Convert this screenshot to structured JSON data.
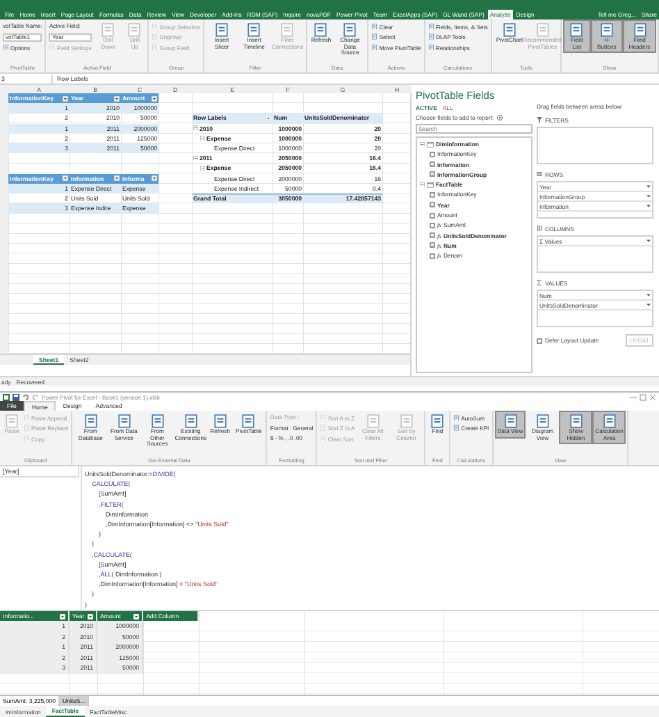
{
  "excel": {
    "ribbon_tabs": [
      {
        "label": "File",
        "selected": false
      },
      {
        "label": "Home",
        "selected": false
      },
      {
        "label": "Insert",
        "selected": false
      },
      {
        "label": "Page Layout",
        "selected": false
      },
      {
        "label": "Formulas",
        "selected": false
      },
      {
        "label": "Data",
        "selected": false
      },
      {
        "label": "Review",
        "selected": false
      },
      {
        "label": "View",
        "selected": false
      },
      {
        "label": "Developer",
        "selected": false
      },
      {
        "label": "Add-ins",
        "selected": false
      },
      {
        "label": "RDM (SAP)",
        "selected": false
      },
      {
        "label": "Inquire",
        "selected": false
      },
      {
        "label": "novaPDF",
        "selected": false
      },
      {
        "label": "Power Pivot",
        "selected": false
      },
      {
        "label": "Team",
        "selected": false
      },
      {
        "label": "ExcelApps (SAP)",
        "selected": false
      },
      {
        "label": "GL Wand (SAP)",
        "selected": false
      },
      {
        "label": "Analyze",
        "selected": true
      },
      {
        "label": "Design",
        "selected": false
      }
    ],
    "tell_me": "Tell me Greg...",
    "share": "Share",
    "ribbon_groups": [
      {
        "label": "PivotTable",
        "buttons": [
          {
            "label": "votTable Name:",
            "kind": "label"
          },
          {
            "label": "votTable1",
            "kind": "field"
          },
          {
            "label": "Options",
            "kind": "small",
            "disabled": false,
            "pressed": false
          }
        ]
      },
      {
        "label": "Active Field",
        "buttons": [
          {
            "label": "Active Field:",
            "kind": "label"
          },
          {
            "label": "Year",
            "kind": "field"
          },
          {
            "label": "Field Settings",
            "kind": "small",
            "disabled": true,
            "pressed": false
          },
          {
            "label": "Drill Down",
            "kind": "large",
            "disabled": true,
            "pressed": false
          },
          {
            "label": "Drill Up",
            "kind": "large",
            "disabled": true,
            "pressed": false
          }
        ]
      },
      {
        "label": "Group",
        "buttons": [
          {
            "label": "Group Selection",
            "kind": "small",
            "disabled": true,
            "pressed": false
          },
          {
            "label": "Ungroup",
            "kind": "small",
            "disabled": true,
            "pressed": false
          },
          {
            "label": "Group Field",
            "kind": "small",
            "disabled": true,
            "pressed": false
          }
        ]
      },
      {
        "label": "Filter",
        "buttons": [
          {
            "label": "Insert Slicer",
            "kind": "large",
            "disabled": false,
            "pressed": false
          },
          {
            "label": "Insert Timeline",
            "kind": "large",
            "disabled": false,
            "pressed": false
          },
          {
            "label": "Filter Connections",
            "kind": "large",
            "disabled": true,
            "pressed": false
          }
        ]
      },
      {
        "label": "Data",
        "buttons": [
          {
            "label": "Refresh",
            "kind": "large",
            "disabled": false,
            "pressed": false
          },
          {
            "label": "Change Data Source",
            "kind": "large",
            "disabled": false,
            "pressed": false
          }
        ]
      },
      {
        "label": "Actions",
        "buttons": [
          {
            "label": "Clear",
            "kind": "small",
            "disabled": false,
            "pressed": false
          },
          {
            "label": "Select",
            "kind": "small",
            "disabled": false,
            "pressed": false
          },
          {
            "label": "Move PivotTable",
            "kind": "small",
            "disabled": false,
            "pressed": false
          }
        ]
      },
      {
        "label": "Calculations",
        "buttons": [
          {
            "label": "Fields, Items, & Sets",
            "kind": "small",
            "disabled": false,
            "pressed": false
          },
          {
            "label": "OLAP Tools",
            "kind": "small",
            "disabled": false,
            "pressed": false
          },
          {
            "label": "Relationships",
            "kind": "small",
            "disabled": false,
            "pressed": false
          }
        ]
      },
      {
        "label": "Tools",
        "buttons": [
          {
            "label": "PivotChart",
            "kind": "large",
            "disabled": false,
            "pressed": false
          },
          {
            "label": "Recommended PivotTables",
            "kind": "large",
            "disabled": true,
            "pressed": false
          }
        ]
      },
      {
        "label": "Show",
        "buttons": [
          {
            "label": "Field List",
            "kind": "large",
            "disabled": false,
            "pressed": true
          },
          {
            "label": "+/- Buttons",
            "kind": "large",
            "disabled": false,
            "pressed": true
          },
          {
            "label": "Field Headers",
            "kind": "large",
            "disabled": false,
            "pressed": true
          }
        ]
      }
    ],
    "name_box": "3",
    "formula": "Row Labels",
    "sheet": {
      "columns": [
        "A",
        "B",
        "C",
        "D",
        "E",
        "F",
        "G",
        "H"
      ],
      "tables": [
        {
          "header": [
            "InformationKey",
            "Year",
            "Amount"
          ],
          "rows": [
            [
              "1",
              "2010",
              "1000000"
            ],
            [
              "2",
              "2010",
              "50000"
            ],
            [
              "1",
              "2011",
              "2000000"
            ],
            [
              "2",
              "2011",
              "125000"
            ],
            [
              "3",
              "2011",
              "50000"
            ]
          ]
        },
        {
          "header": [
            "InformationKey",
            "Information",
            "Informa"
          ],
          "rows": [
            [
              "1",
              "Expense Direct",
              "Expense"
            ],
            [
              "2",
              "Units Sold",
              "Units Sold"
            ],
            [
              "3",
              "Expense Indire",
              "Expense"
            ]
          ]
        }
      ],
      "pivot": {
        "columns": [
          "Row Labels",
          "Num",
          "UnitsSoldDenominator"
        ],
        "rows": [
          {
            "label": "2010",
            "values": [
              "1000000",
              "20"
            ],
            "expanded": true,
            "children": [
              {
                "label": "Expense",
                "values": [
                  "1000000",
                  "20"
                ],
                "expanded": true,
                "children": [
                  {
                    "label": "Expense Direct",
                    "values": [
                      "1000000",
                      "20"
                    ]
                  }
                ]
              }
            ]
          },
          {
            "label": "2011",
            "values": [
              "2050000",
              "16.4"
            ],
            "expanded": true,
            "children": [
              {
                "label": "Expense",
                "values": [
                  "2050000",
                  "16.4"
                ],
                "expanded": true,
                "children": [
                  {
                    "label": "Expense Direct",
                    "values": [
                      "2000000",
                      "16"
                    ]
                  },
                  {
                    "label": "Expense Indirect",
                    "values": [
                      "50000",
                      "0.4"
                    ]
                  }
                ]
              }
            ]
          }
        ],
        "grand_total": {
          "label": "Grand Total",
          "values": [
            "3050000",
            "17.42857143"
          ]
        }
      }
    },
    "sheet_tabs": [
      {
        "label": "Sheet1",
        "selected": true
      },
      {
        "label": "Sheet2",
        "selected": false
      }
    ],
    "status": [
      "ady",
      "Recovered"
    ],
    "field_list": {
      "title": "PivotTable Fields",
      "tabs": [
        {
          "label": "ACTIVE",
          "selected": true
        },
        {
          "label": "ALL",
          "selected": false
        }
      ],
      "choose_label": "Choose fields to add to report:",
      "search": {
        "placeholder": "Search"
      },
      "tables": [
        {
          "name": "DimInformation",
          "expanded": true,
          "fields": [
            {
              "name": "InformationKey",
              "kind": "column",
              "checked": false
            },
            {
              "name": "Information",
              "kind": "column",
              "checked": true
            },
            {
              "name": "InformationGroup",
              "kind": "column",
              "checked": true
            }
          ]
        },
        {
          "name": "FactTable",
          "expanded": true,
          "fields": [
            {
              "name": "InformationKey",
              "kind": "column",
              "checked": false
            },
            {
              "name": "Year",
              "kind": "column",
              "checked": true
            },
            {
              "name": "Amount",
              "kind": "column",
              "checked": false
            },
            {
              "name": "SumAmt",
              "kind": "measure",
              "symbol": "fx",
              "checked": false
            },
            {
              "name": "UnitsSoldDenominator",
              "kind": "measure",
              "symbol": "fx",
              "checked": true
            },
            {
              "name": "Num",
              "kind": "measure",
              "symbol": "fx",
              "checked": true
            },
            {
              "name": "Denom",
              "kind": "measure",
              "symbol": "fx",
              "checked": false
            }
          ]
        }
      ],
      "drag_label": "Drag fields between areas below:",
      "areas": [
        {
          "label": "FILTERS"
        },
        {
          "label": "ROWS",
          "items": [
            "Year",
            "InformationGroup",
            "Information"
          ]
        },
        {
          "label": "COLUMNS",
          "items": [
            "Σ Values"
          ]
        },
        {
          "label": "VALUES",
          "items": [
            "Num",
            "UnitsSoldDenominator"
          ]
        }
      ],
      "defer": {
        "label": "Defer Layout Update",
        "checked": false
      },
      "update": {
        "label": "UPDAT",
        "disabled": true
      }
    }
  },
  "power_pivot": {
    "title": "Power Pivot for Excel - Book1 (version 1).xlsb",
    "tabs": [
      {
        "label": "File",
        "kind": "file",
        "selected": false
      },
      {
        "label": "Home",
        "kind": "tab",
        "selected": true
      },
      {
        "label": "Design",
        "kind": "tab",
        "selected": false
      },
      {
        "label": "Advanced",
        "kind": "tab",
        "selected": false
      }
    ],
    "ribbon_groups": [
      {
        "label": "Clipboard",
        "buttons": [
          {
            "label": "Paste",
            "kind": "large",
            "disabled": true,
            "pressed": false
          },
          {
            "label": "Paste Append",
            "kind": "small",
            "disabled": true,
            "pressed": false
          },
          {
            "label": "Paste Replace",
            "kind": "small",
            "disabled": true,
            "pressed": false
          },
          {
            "label": "Copy",
            "kind": "small",
            "disabled": true,
            "pressed": false
          }
        ]
      },
      {
        "label": "Get External Data",
        "buttons": [
          {
            "label": "From Database",
            "kind": "large",
            "disabled": false,
            "pressed": false
          },
          {
            "label": "From Data Service",
            "kind": "large",
            "disabled": false,
            "pressed": false
          },
          {
            "label": "From Other Sources",
            "kind": "large",
            "disabled": false,
            "pressed": false
          },
          {
            "label": "Existing Connections",
            "kind": "large",
            "disabled": false,
            "pressed": false
          },
          {
            "label": "Refresh",
            "kind": "large",
            "disabled": false,
            "pressed": false
          },
          {
            "label": "PivotTable",
            "kind": "large",
            "disabled": false,
            "pressed": false
          }
        ]
      },
      {
        "label": "Formatting",
        "buttons": [
          {
            "label": "Data Type :",
            "kind": "label",
            "disabled": true
          },
          {
            "label": "Format : General",
            "kind": "label",
            "disabled": false
          },
          {
            "label": "$ - % , .0 .00",
            "kind": "label",
            "disabled": false
          }
        ]
      },
      {
        "label": "Sort and Filter",
        "buttons": [
          {
            "label": "Sort A to Z",
            "kind": "small",
            "disabled": true,
            "pressed": false
          },
          {
            "label": "Sort Z to A",
            "kind": "small",
            "disabled": true,
            "pressed": false
          },
          {
            "label": "Clear Sort",
            "kind": "small",
            "disabled": true,
            "pressed": false
          },
          {
            "label": "Clear All Filters",
            "kind": "large",
            "disabled": true,
            "pressed": false
          },
          {
            "label": "Sort by Column",
            "kind": "large",
            "disabled": true,
            "pressed": false
          }
        ]
      },
      {
        "label": "Find",
        "buttons": [
          {
            "label": "Find",
            "kind": "large",
            "disabled": false,
            "pressed": false
          }
        ]
      },
      {
        "label": "Calculations",
        "buttons": [
          {
            "label": "AutoSum",
            "kind": "small",
            "disabled": false,
            "pressed": false
          },
          {
            "label": "Create KPI",
            "kind": "small",
            "disabled": false,
            "pressed": false
          }
        ]
      },
      {
        "label": "View",
        "buttons": [
          {
            "label": "Data View",
            "kind": "large",
            "disabled": false,
            "pressed": true
          },
          {
            "label": "Diagram View",
            "kind": "large",
            "disabled": false,
            "pressed": false
          },
          {
            "label": "Show Hidden",
            "kind": "large",
            "disabled": false,
            "pressed": true
          },
          {
            "label": "Calculation Area",
            "kind": "large",
            "disabled": false,
            "pressed": true
          }
        ]
      }
    ],
    "column_name": "[Year]",
    "formula_lines": [
      [
        {
          "text": "UnitsSoldDenominator:=",
          "kind": "plain"
        },
        {
          "text": "DIVIDE(",
          "kind": "keyword"
        }
      ],
      [
        {
          "text": "    CALCULATE(",
          "kind": "keyword"
        }
      ],
      [
        {
          "text": "        [SumAmt]",
          "kind": "plain"
        }
      ],
      [
        {
          "text": "        ,FILTER(",
          "kind": "keyword"
        }
      ],
      [
        {
          "text": "            DimInformation",
          "kind": "plain"
        }
      ],
      [
        {
          "text": "            ,DimInformation[Information] <> ",
          "kind": "plain"
        },
        {
          "text": "\"Units Sold\"",
          "kind": "string"
        }
      ],
      [
        {
          "text": "        )",
          "kind": "plain"
        }
      ],
      [
        {
          "text": "    )",
          "kind": "plain"
        }
      ],
      [
        {
          "text": "    ,CALCULATE(",
          "kind": "keyword"
        }
      ],
      [
        {
          "text": "        [SumAmt]",
          "kind": "plain"
        }
      ],
      [
        {
          "text": "        ,ALL(",
          "kind": "keyword"
        },
        {
          "text": " DimInformation )",
          "kind": "plain"
        }
      ],
      [
        {
          "text": "        ,DimInformation[Information] = ",
          "kind": "plain"
        },
        {
          "text": "\"Units Sold\"",
          "kind": "string"
        }
      ],
      [
        {
          "text": "    )",
          "kind": "plain"
        }
      ],
      [
        {
          "text": ")",
          "kind": "plain"
        }
      ]
    ],
    "table": {
      "columns": [
        "Informatio...",
        "Year",
        "Amount",
        "Add Column"
      ],
      "rows": [
        [
          "1",
          "2010",
          "1000000"
        ],
        [
          "2",
          "2010",
          "50000"
        ],
        [
          "1",
          "2011",
          "2000000"
        ],
        [
          "2",
          "2011",
          "125000"
        ],
        [
          "3",
          "2011",
          "50000"
        ]
      ]
    },
    "measures": [
      "SumAmt: 3,225,000",
      "UnitsS..."
    ],
    "sheet_tabs": [
      {
        "label": "imInformation",
        "selected": false
      },
      {
        "label": "FactTable",
        "selected": true
      },
      {
        "label": "FactTableMisc",
        "selected": false
      }
    ]
  }
}
